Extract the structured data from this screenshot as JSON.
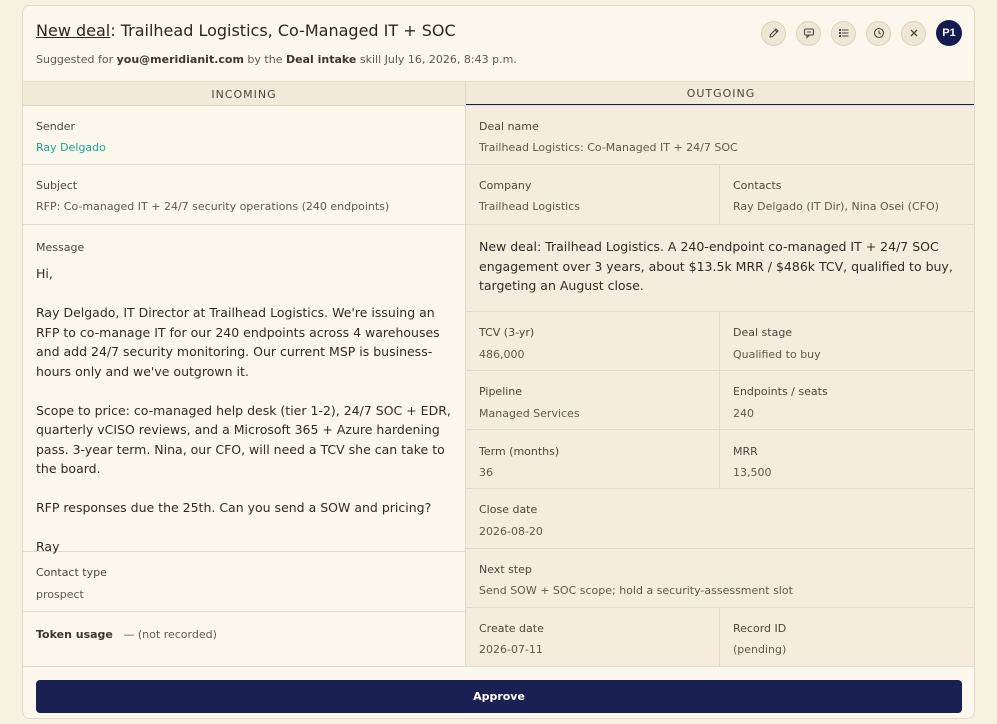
{
  "header": {
    "title_lead": "New deal",
    "title_rest": ": Trailhead Logistics, Co-Managed IT + SOC",
    "subtitle_prefix": "Suggested for ",
    "subtitle_user": "you@meridianit.com",
    "subtitle_mid": " by the ",
    "subtitle_skill": "Deal intake",
    "subtitle_suffix": " skill July 16, 2026, 8:43 p.m.",
    "avatar": "P1",
    "icons": [
      "edit-icon",
      "comment-icon",
      "list-icon",
      "clock-icon",
      "close-icon"
    ]
  },
  "columns": {
    "incoming": "INCOMING",
    "outgoing": "OUTGOING"
  },
  "incoming": {
    "sender_label": "Sender",
    "sender_value": "Ray Delgado",
    "subject_label": "Subject",
    "subject_value": "RFP: Co-managed IT + 24/7 security operations (240 endpoints)",
    "message_label": "Message",
    "message_paragraphs": [
      "Hi,",
      "Ray Delgado, IT Director at Trailhead Logistics. We're issuing an RFP to co-manage IT for our 240 endpoints across 4 warehouses and add 24/7 security monitoring. Our current MSP is business-hours only and we've outgrown it.",
      "Scope to price: co-managed help desk (tier 1-2), 24/7 SOC + EDR, quarterly vCISO reviews, and a Microsoft 365 + Azure hardening pass. 3-year term. Nina, our CFO, will need a TCV she can take to the board.",
      "RFP responses due the 25th. Can you send a SOW and pricing?",
      "Ray"
    ],
    "contact_type_label": "Contact type",
    "contact_type_value": "prospect",
    "token_label": "Token usage",
    "token_value": "— (not recorded)"
  },
  "outgoing": {
    "deal_name_label": "Deal name",
    "deal_name_value": "Trailhead Logistics: Co-Managed IT + 24/7 SOC",
    "company_label": "Company",
    "company_value": "Trailhead Logistics",
    "contacts_label": "Contacts",
    "contacts_value": "Ray Delgado (IT Dir), Nina Osei (CFO)",
    "summary": "New deal: Trailhead Logistics. A 240-endpoint co-managed IT + 24/7 SOC engagement over 3 years, about $13.5k MRR / $486k TCV, qualified to buy, targeting an August close.",
    "tcv_label": "TCV (3-yr)",
    "tcv_value": "486,000",
    "stage_label": "Deal stage",
    "stage_value": "Qualified to buy",
    "pipeline_label": "Pipeline",
    "pipeline_value": "Managed Services",
    "endpoints_label": "Endpoints / seats",
    "endpoints_value": "240",
    "term_label": "Term (months)",
    "term_value": "36",
    "mrr_label": "MRR",
    "mrr_value": "13,500",
    "close_label": "Close date",
    "close_value": "2026-08-20",
    "next_label": "Next step",
    "next_value": "Send SOW + SOC scope; hold a security-assessment slot",
    "create_label": "Create date",
    "create_value": "2026-07-11",
    "record_label": "Record ID",
    "record_value": "(pending)"
  },
  "footer": {
    "approve_label": "Approve"
  }
}
